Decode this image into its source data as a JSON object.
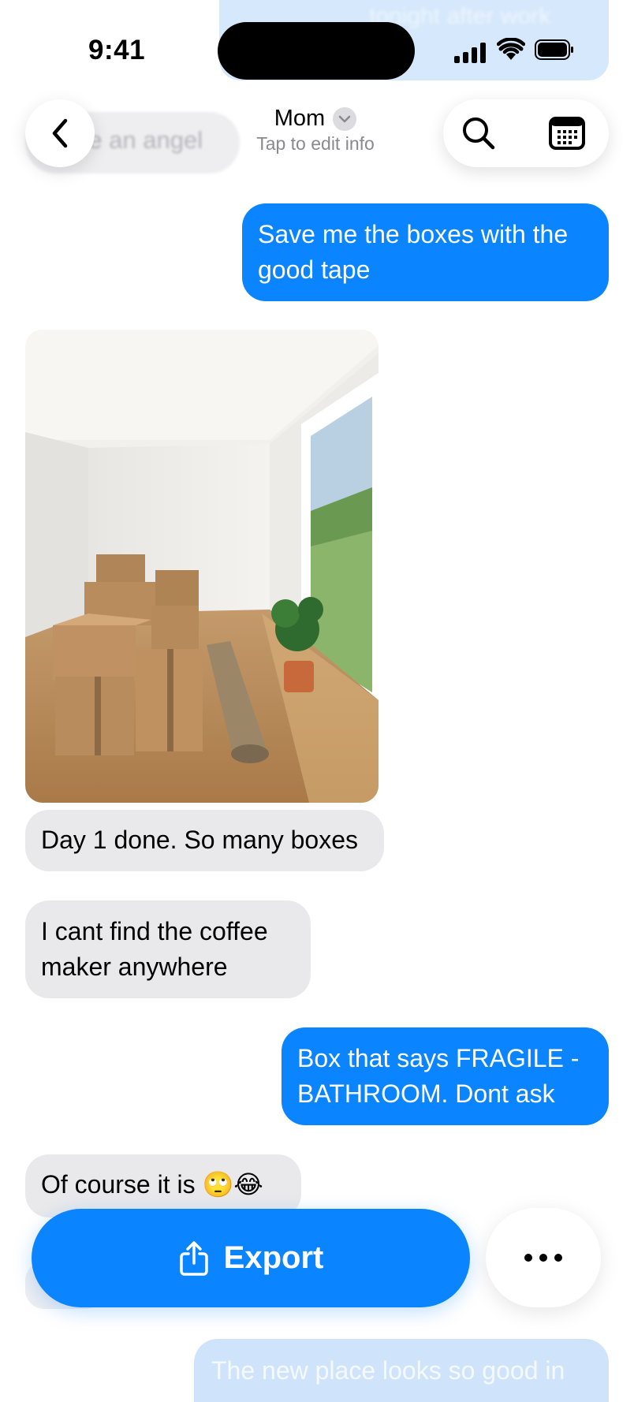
{
  "status_bar": {
    "time": "9:41"
  },
  "header": {
    "contact_name": "Mom",
    "subtitle": "Tap to edit info",
    "faint_top_text": "tonight after work",
    "faint_gray_text": "re an angel"
  },
  "messages": [
    {
      "direction": "outgoing",
      "text": "Save me the boxes with the good tape"
    },
    {
      "direction": "incoming",
      "type": "photo",
      "alt_icon": "moving-boxes-photo"
    },
    {
      "direction": "incoming",
      "text": "Day 1 done. So many boxes"
    },
    {
      "direction": "incoming",
      "text": "I cant find the coffee maker anywhere"
    },
    {
      "direction": "outgoing",
      "text": "Box that says FRAGILE - BATHROOM. Dont ask"
    },
    {
      "direction": "incoming",
      "text": "Of course it is 🙄😂"
    },
    {
      "direction": "outgoing",
      "text": "The new place looks so good in"
    }
  ],
  "bottom_bar": {
    "export_label": "Export"
  },
  "colors": {
    "accent": "#0a84ff",
    "incoming_bubble": "#e9e9eb"
  },
  "icons": [
    "back-chevron-icon",
    "search-icon",
    "calendar-icon",
    "share-icon",
    "more-icon",
    "signal-icon",
    "wifi-icon",
    "battery-icon"
  ]
}
